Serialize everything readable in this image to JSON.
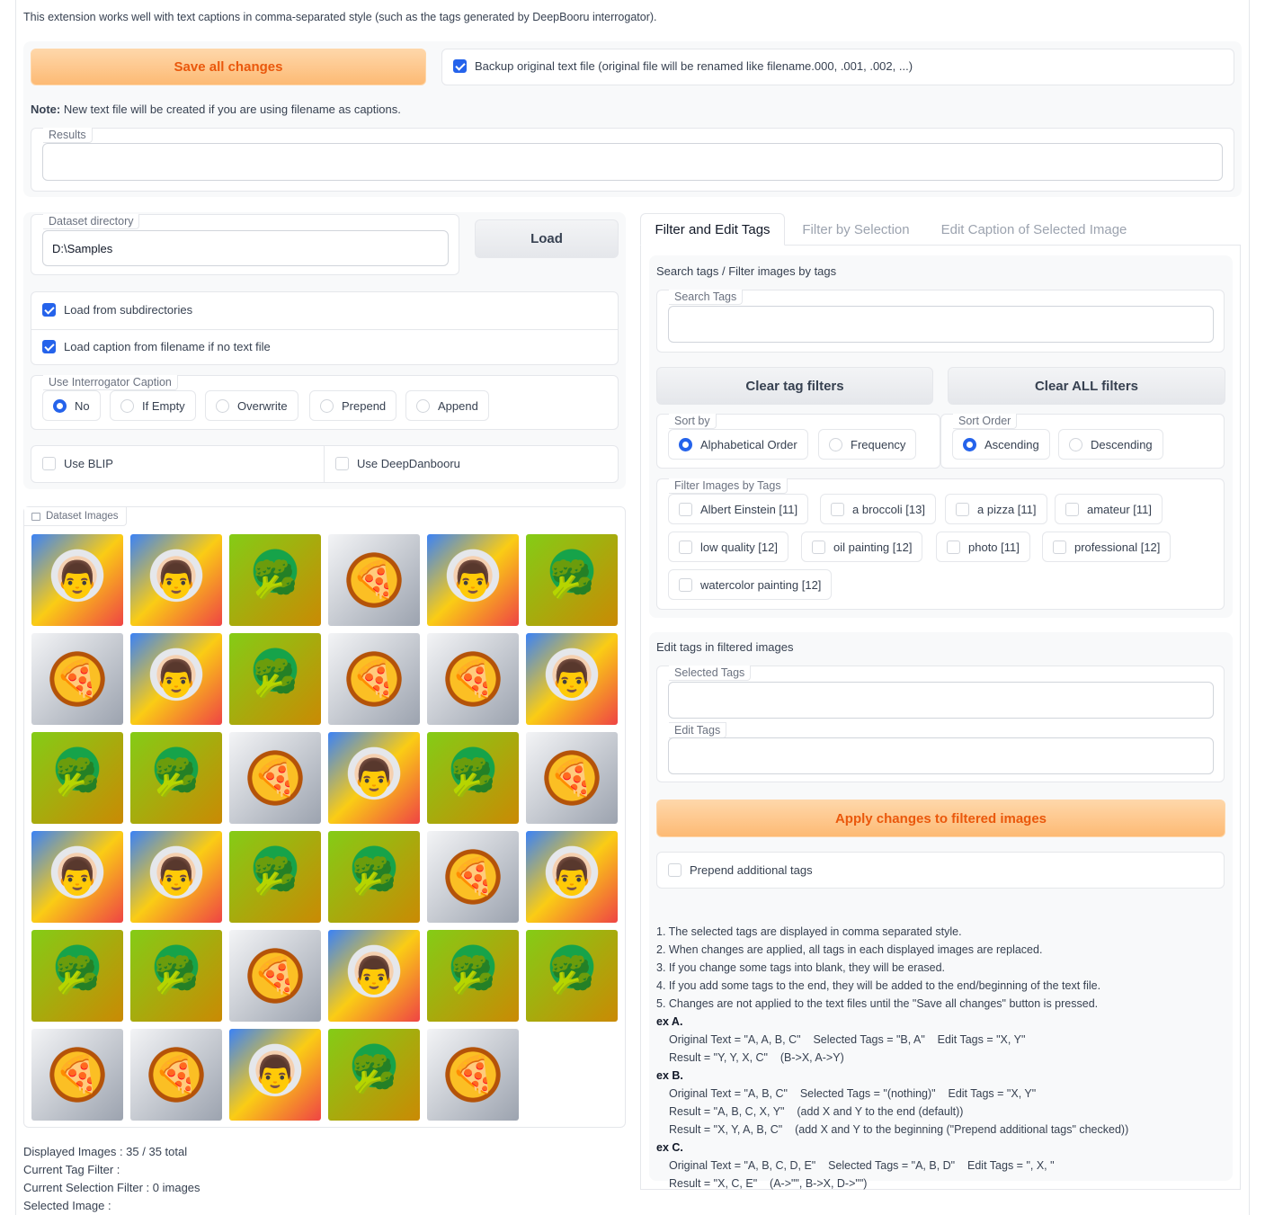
{
  "intro": "This extension works well with text captions in comma-separated style (such as the tags generated by DeepBooru interrogator).",
  "save_button": "Save all changes",
  "backup_label": "Backup original text file (original file will be renamed like filename.000, .001, .002, ...)",
  "note_bold": "Note:",
  "note_text": "New text file will be created if you are using filename as captions.",
  "results_label": "Results",
  "results_value": "",
  "dataset_dir_label": "Dataset directory",
  "dataset_dir_value": "D:\\Samples",
  "load_button": "Load",
  "load_subdirs": "Load from subdirectories",
  "load_caption_filename": "Load caption from filename if no text file",
  "interrogator_label": "Use Interrogator Caption",
  "interrogator_options": [
    "No",
    "If Empty",
    "Overwrite",
    "Prepend",
    "Append"
  ],
  "interrogator_selected": "No",
  "use_blip": "Use BLIP",
  "use_deepdanbooru": "Use DeepDanbooru",
  "gallery_label": "Dataset Images",
  "gallery": [
    "einstein",
    "einstein",
    "broccoli",
    "pizza",
    "einstein",
    "broccoli",
    "pizza",
    "einstein",
    "broccoli",
    "pizza",
    "pizza",
    "einstein",
    "broccoli",
    "broccoli",
    "pizza",
    "einstein",
    "broccoli",
    "pizza",
    "einstein",
    "einstein",
    "broccoli",
    "broccoli",
    "pizza",
    "einstein",
    "broccoli",
    "broccoli",
    "pizza",
    "einstein",
    "broccoli",
    "broccoli",
    "pizza",
    "pizza",
    "einstein",
    "broccoli",
    "pizza"
  ],
  "status": {
    "displayed": "Displayed Images : 35 / 35 total",
    "tag_filter": "Current Tag Filter :",
    "selection_filter": "Current Selection Filter : 0 images",
    "selected_image": "Selected Image :"
  },
  "tabs": [
    "Filter and Edit Tags",
    "Filter by Selection",
    "Edit Caption of Selected Image"
  ],
  "active_tab": "Filter and Edit Tags",
  "search_header": "Search tags / Filter images by tags",
  "search_label": "Search Tags",
  "search_value": "",
  "clear_tag_filters": "Clear tag filters",
  "clear_all_filters": "Clear ALL filters",
  "sort_by_label": "Sort by",
  "sort_by_options": [
    "Alphabetical Order",
    "Frequency"
  ],
  "sort_by_selected": "Alphabetical Order",
  "sort_order_label": "Sort Order",
  "sort_order_options": [
    "Ascending",
    "Descending"
  ],
  "sort_order_selected": "Ascending",
  "filter_tags_label": "Filter Images by Tags",
  "filter_tags": [
    "Albert Einstein [11]",
    "a broccoli [13]",
    "a pizza [11]",
    "amateur [11]",
    "low quality [12]",
    "oil painting [12]",
    "photo [11]",
    "professional [12]",
    "watercolor painting [12]"
  ],
  "edit_header": "Edit tags in filtered images",
  "selected_tags_label": "Selected Tags",
  "selected_tags_value": "",
  "edit_tags_label": "Edit Tags",
  "edit_tags_value": "",
  "apply_button": "Apply changes to filtered images",
  "prepend_label": "Prepend additional tags",
  "instructions": [
    "1. The selected tags are displayed in comma separated style.",
    "2. When changes are applied, all tags in each displayed images are replaced.",
    "3. If you change some tags into blank, they will be erased.",
    "4. If you add some tags to the end, they will be added to the end/beginning of the text file.",
    "5. Changes are not applied to the text files until the \"Save all changes\" button is pressed."
  ],
  "examples": [
    {
      "title": "ex A.",
      "lines": [
        "Original Text = \"A, A, B, C\"    Selected Tags = \"B, A\"    Edit Tags = \"X, Y\"",
        "Result = \"Y, Y, X, C\"    (B->X, A->Y)"
      ]
    },
    {
      "title": "ex B.",
      "lines": [
        "Original Text = \"A, B, C\"    Selected Tags = \"(nothing)\"    Edit Tags = \"X, Y\"",
        "Result = \"A, B, C, X, Y\"    (add X and Y to the end (default))",
        "Result = \"X, Y, A, B, C\"    (add X and Y to the beginning (\"Prepend additional tags\" checked))"
      ]
    },
    {
      "title": "ex C.",
      "lines": [
        "Original Text = \"A, B, C, D, E\"    Selected Tags = \"A, B, D\"    Edit Tags = \", X, \"",
        "Result = \"X, C, E\"    (A->\"\", B->X, D->\"\")"
      ]
    }
  ],
  "colors": {
    "accent": "#2563eb",
    "orange_text": "#ea580c",
    "orange_bg": "#fdba74"
  }
}
